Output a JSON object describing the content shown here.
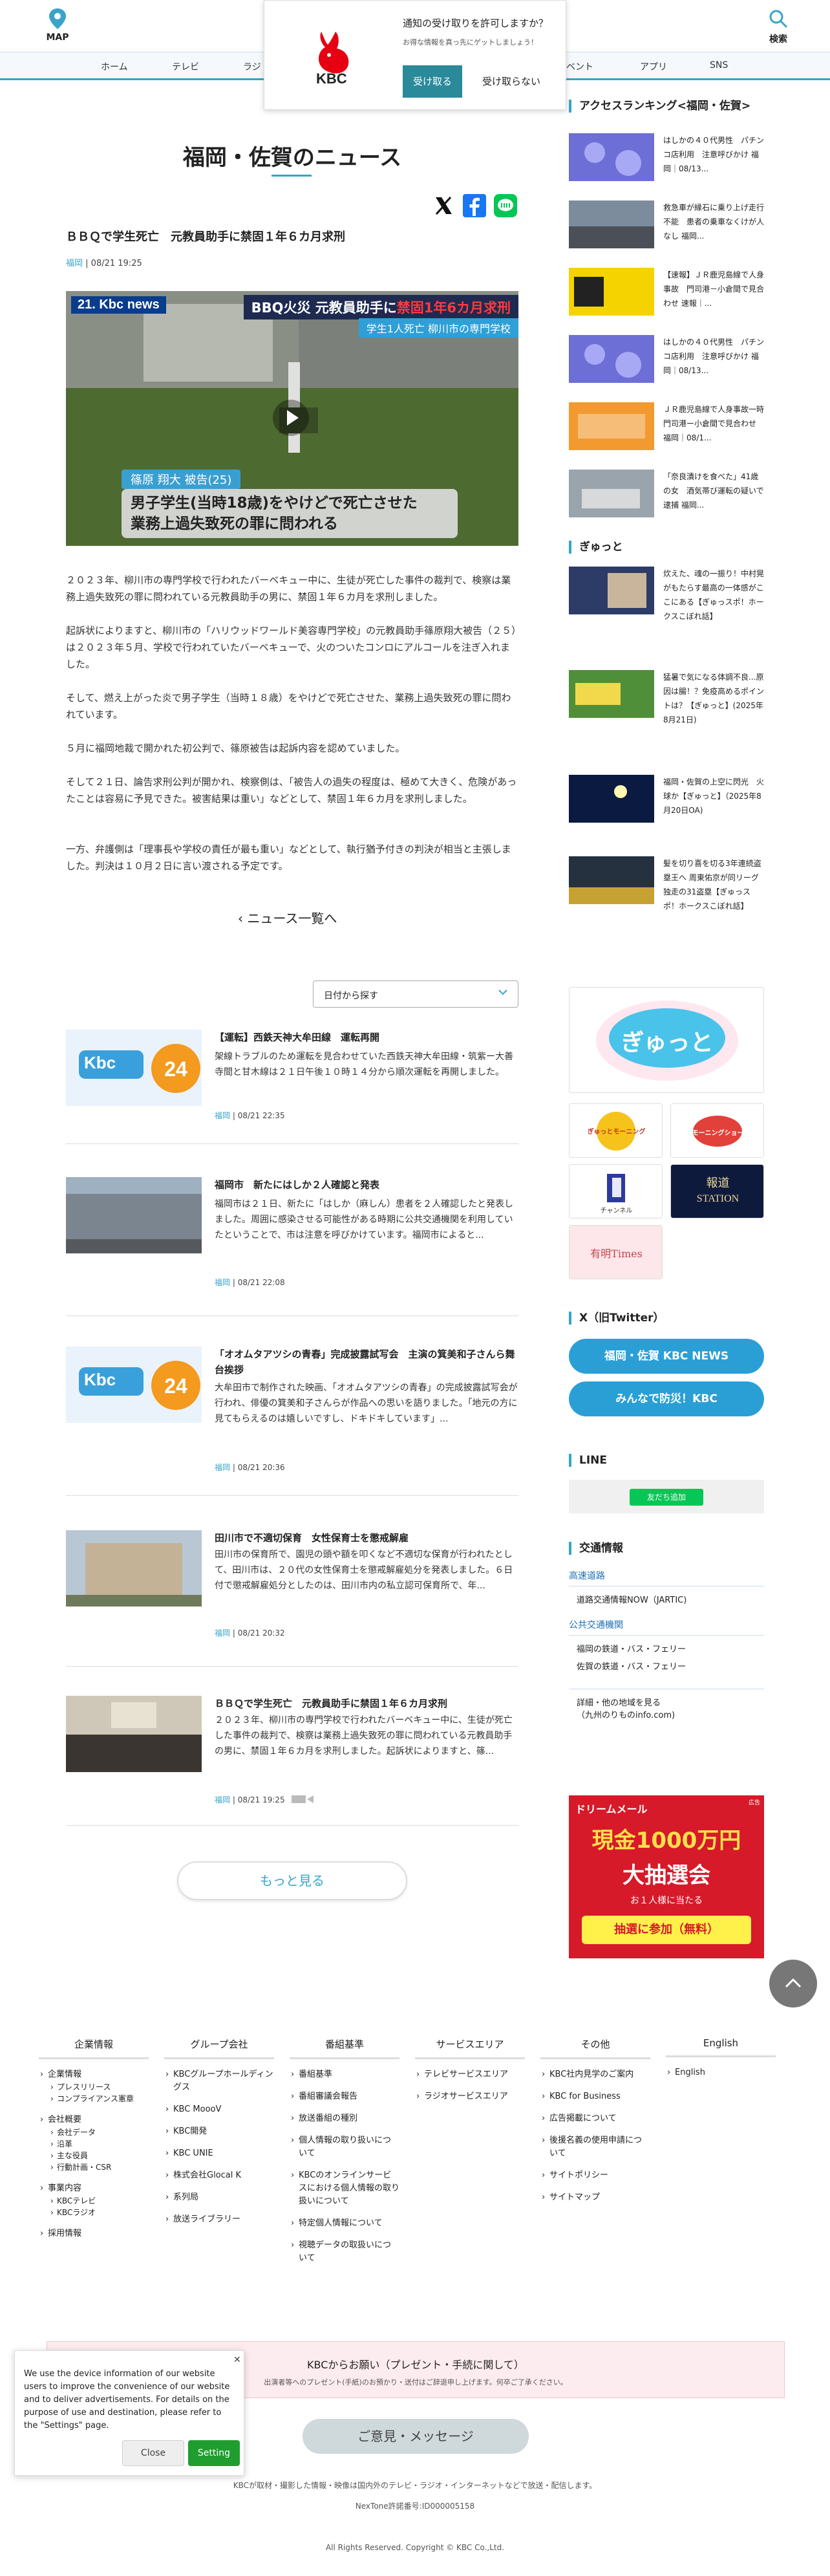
{
  "header": {
    "map_label": "MAP",
    "search_label": "検索",
    "nav": [
      "ホーム",
      "テレビ",
      "ラジ",
      "ベント",
      "アプリ",
      "SNS"
    ]
  },
  "notify_popup": {
    "logo_text": "KBC",
    "question": "通知の受け取りを許可しますか？",
    "sub": "お得な情報を真っ先にゲットしましょう！",
    "accept": "受け取る",
    "deny": "受け取らない"
  },
  "page": {
    "title": "福岡・佐賀のニュース"
  },
  "article": {
    "headline": "ＢＢＱで学生死亡　元教員助手に禁固１年６カ月求刑",
    "category": "福岡",
    "datetime": "08/21 19:25",
    "hero": {
      "brand": "21. Kbc news",
      "banner_top": "BBQ火災 元教員助手に禁固1年6カ月求刑",
      "banner_top_prefix": "BBQ火災 元教員助手に",
      "banner_top_suffix": "禁固1年6カ月求刑",
      "banner_sub": "学生1人死亡 柳川市の専門学校",
      "name_tag": "篠原 翔大 被告(25)",
      "caption_line1": "男子学生(当時18歳)をやけどで死亡させた",
      "caption_line2": "業務上過失致死の罪に問われる"
    },
    "paragraphs": [
      "２０２３年、柳川市の専門学校で行われたバーベキュー中に、生徒が死亡した事件の裁判で、検察は業務上過失致死の罪に問われている元教員助手の男に、禁固１年６カ月を求刑しました。",
      "起訴状によりますと、柳川市の「ハリウッドワールド美容専門学校」の元教員助手篠原翔大被告（２５）は２０２３年５月、学校で行われていたバーベキューで、火のついたコンロにアルコールを注ぎ入れました。",
      "そして、燃え上がった炎で男子学生（当時１８歳）をやけどで死亡させた、業務上過失致死の罪に問われています。",
      "５月に福岡地裁で開かれた初公判で、篠原被告は起訴内容を認めていました。",
      "そして２１日、論告求刑公判が開かれ、検察側は、「被告人の過失の程度は、極めて大きく、危険があったことは容易に予見できた。被害結果は重い」などとして、禁固１年６カ月を求刑しました。",
      "一方、弁護側は「理事長や学校の責任が最も重い」などとして、執行猶予付きの判決が相当と主張しました。判決は１０月２日に言い渡される予定です。"
    ]
  },
  "back_link": "ニュース一覧へ",
  "date_select_placeholder": "日付から探す",
  "news_list": [
    {
      "title": "【運転】西鉄天神大牟田線　運転再開",
      "desc": "架線トラブルのため運転を見合わせていた西鉄天神大牟田線・筑紫ー大善寺間と甘木線は２１日午後１０時１４分から順次運転を再開しました。",
      "category": "福岡",
      "datetime": "08/21 22:35",
      "thumb": "kbc-news-24"
    },
    {
      "title": "福岡市　新たにはしか２人確認と発表",
      "desc": "福岡市は２１日、新たに「はしか（麻しん）患者を２人確認したと発表しました。周囲に感染させる可能性がある時期に公共交通機関を利用していたということで、市は注意を呼びかけています。福岡市によると...",
      "category": "福岡",
      "datetime": "08/21 22:08",
      "thumb": "city-building"
    },
    {
      "title": "「オオムタアツシの青春」完成披露試写会　主演の箕美和子さんら舞台挨拶",
      "desc": "大牟田市で制作された映画、「オオムタアツシの青春」の完成披露試写会が行われ、俳優の箕美和子さんらが作品への思いを語りました。「地元の方に見てもらえるのは嬉しいですし、ドキドキしています」...",
      "category": "福岡",
      "datetime": "08/21 20:36",
      "thumb": "kbc-news-24"
    },
    {
      "title": "田川市で不適切保育　女性保育士を懲戒解雇",
      "desc": "田川市の保育所で、園児の頭や額を叩くなど不適切な保育が行われたとして、田川市は、２０代の女性保育士を懲戒解雇処分を発表しました。６日付で懲戒解雇処分としたのは、田川市内の私立認可保育所で、年...",
      "category": "福岡",
      "datetime": "08/21 20:32",
      "thumb": "building-brown"
    },
    {
      "title": "ＢＢＱで学生死亡　元教員助手に禁固１年６カ月求刑",
      "desc": "２０２３年、柳川市の専門学校で行われたバーベキュー中に、生徒が死亡した事件の裁判で、検察は業務上過失致死の罪に問われている元教員助手の男に、禁固１年６カ月を求刑しました。起訴状によりますと、篠...",
      "category": "福岡",
      "datetime": "08/21 19:25",
      "thumb": "press-conf"
    }
  ],
  "more_button": "もっと見る",
  "sidebar": {
    "ranking_title": "アクセスランキング<福岡・佐賀>",
    "ranking": [
      {
        "text": "はしかの４０代男性　パチンコ店利用　注意呼びかけ 福岡｜08/13...",
        "thumb": "purple-virus"
      },
      {
        "text": "救急車が縁石に乗り上げ走行不能　患者の乗車なくけが人なし 福岡...",
        "thumb": "road"
      },
      {
        "text": "【速報】ＪＲ鹿児島線で人身事故　門司港－小倉間で見合わせ 速報｜...",
        "thumb": "yellow-board"
      },
      {
        "text": "はしかの４０代男性　パチンコ店利用　注意呼びかけ 福岡｜08/13...",
        "thumb": "purple-virus"
      },
      {
        "text": "ＪＲ鹿児島線で人身事故一時　門司港ー小倉間で見合わせ 福岡｜08/1...",
        "thumb": "orange-traffic"
      },
      {
        "text": "「奈良漬けを食べた」41歳の女　酒気帯び運転の疑いで逮捕 福岡...",
        "thumb": "car"
      }
    ],
    "gyutto_title": "ぎゅっと",
    "gyutto": [
      {
        "text": "炊えた、魂の一振り！中村晃がもたらす最高の一体感がここにある【ぎゅっスポ！ホークスこぼれ話】"
      },
      {
        "text": "猛暑で気になる体調不良...原因は腸！？免疫高めるポイントは？【ぎゅっと】(2025年8月21日)"
      },
      {
        "text": "福岡・佐賀の上空に閃光　火球か【ぎゅっと】（2025年8月20日OA)"
      },
      {
        "text": "髪を切り喜を切る3年連続盗塁王へ 周東佑京が同リーグ独走の31盗塁【ぎゅっスポ！ホークスこぼれ話】"
      }
    ],
    "banners": {
      "gyutto_logo": "ぎゅっと",
      "morning": "ぎゅっとモーニング",
      "morning_show": "モーニングショー",
      "channel": "チャンネル",
      "station_line1": "報道",
      "station_line2": "STATION",
      "times": "有明Times"
    },
    "x_title": "X（旧Twitter）",
    "x_buttons": [
      "福岡・佐賀 KBC NEWS",
      "みんなで防災！KBC"
    ],
    "line_title": "LINE",
    "line_button": "友だち追加",
    "traffic_title": "交通情報",
    "traffic": {
      "highway_label": "高速道路",
      "highway_link": "道路交通情報NOW（JARTIC)",
      "public_label": "公共交通機関",
      "public_links": [
        "福岡の鉄道・バス・フェリー",
        "佐賀の鉄道・バス・フェリー"
      ],
      "other_link_line1": "詳細・他の地域を見る",
      "other_link_line2": "（九州のりものinfo.com)"
    },
    "ad": {
      "top": "ドリームメール",
      "big": "現金1000万円",
      "mid": "大抽選会",
      "small": "お１人様に当たる",
      "cta": "抽選に参加（無料）",
      "label": "広告"
    }
  },
  "footer": {
    "columns": [
      {
        "head": "企業情報",
        "links": [
          {
            "label": "企業情報",
            "subs": [
              "プレスリリース",
              "コンプライアンス憲章"
            ]
          },
          {
            "label": "会社概要",
            "subs": [
              "会社データ",
              "沿革",
              "主な役員",
              "行動計画・CSR"
            ]
          },
          {
            "label": "事業内容",
            "subs": [
              "KBCテレビ",
              "KBCラジオ"
            ]
          },
          {
            "label": "採用情報",
            "subs": []
          }
        ]
      },
      {
        "head": "グループ会社",
        "links": [
          {
            "label": "KBCグループホールディングス",
            "subs": []
          },
          {
            "label": "KBC MoooV",
            "subs": []
          },
          {
            "label": "KBC開発",
            "subs": []
          },
          {
            "label": "KBC UNIE",
            "subs": []
          },
          {
            "label": "株式会社Glocal K",
            "subs": []
          },
          {
            "label": "系列局",
            "subs": []
          },
          {
            "label": "放送ライブラリー",
            "subs": []
          }
        ]
      },
      {
        "head": "番組基準",
        "links": [
          {
            "label": "番組基準",
            "subs": []
          },
          {
            "label": "番組審議会報告",
            "subs": []
          },
          {
            "label": "放送番組の種別",
            "subs": []
          },
          {
            "label": "個人情報の取り扱いについて",
            "subs": []
          },
          {
            "label": "KBCのオンラインサービスにおける個人情報の取り扱いについて",
            "subs": []
          },
          {
            "label": "特定個人情報について",
            "subs": []
          },
          {
            "label": "視聴データの取扱いについて",
            "subs": []
          }
        ]
      },
      {
        "head": "サービスエリア",
        "links": [
          {
            "label": "テレビサービスエリア",
            "subs": []
          },
          {
            "label": "ラジオサービスエリア",
            "subs": []
          }
        ]
      },
      {
        "head": "その他",
        "links": [
          {
            "label": "KBC社内見学のご案内",
            "subs": []
          },
          {
            "label": "KBC for Business",
            "subs": []
          },
          {
            "label": "広告掲載について",
            "subs": []
          },
          {
            "label": "後援名義の使用申請について",
            "subs": []
          },
          {
            "label": "サイトポリシー",
            "subs": []
          },
          {
            "label": "サイトマップ",
            "subs": []
          }
        ]
      },
      {
        "head": "English",
        "links": [
          {
            "label": "English",
            "subs": []
          }
        ]
      }
    ],
    "present_title": "KBCからお願い（プレゼント・手続に関して）",
    "present_sub": "出演者等へのプレゼント(手紙)のお預かり・送付はご辞退申し上げます。何卒ご了承ください。",
    "feedback": "ご意見・メッセージ",
    "note1": "KBCが取材・撮影した情報・映像は国内外のテレビ・ラジオ・インターネットなどで放送・配信します。",
    "note2": "NexTone許諾番号:ID000005158",
    "copyright": "All Rights Reserved. Copyright © KBC Co.,Ltd."
  },
  "cookie": {
    "message": "We use the device information of our website users to improve the convenience of our website and to deliver advertisements. For details on the purpose of use and destination, please refer to the \"Settings\" page.",
    "close": "Close",
    "settings": "Setting"
  },
  "colors": {
    "accent": "#38a4c8",
    "twitter_btn": "#2a9fd6",
    "line_green": "#06c755",
    "kbc_red": "#e60012"
  }
}
